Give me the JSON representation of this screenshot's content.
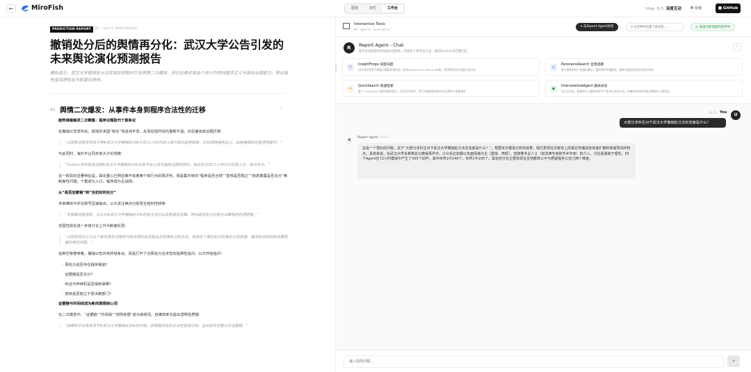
{
  "topbar": {
    "back_icon": "arrow-left-icon",
    "brand": "MiroFish",
    "tabs": [
      "图谱",
      "双栏",
      "工作台"
    ],
    "active_tab": 2,
    "step_prefix": "Step 5/5",
    "step_label": "深度互动",
    "status": "就绪",
    "github": "GitHub"
  },
  "report": {
    "tag": "PREDICTION REPORT",
    "id": "ID: report_899de39a43af",
    "title": "撤销处分后的舆情再分化：武汉大学公告引发的未来舆论演化预测报告",
    "subtitle": "模拟显示，武汉大学撤销处分决定将在短期内引发舆情二次爆发，但讨论焦点将由个体行为转向程序正义与高校治理能力，舆论结构呈现理性化与制度化转向。",
    "section": {
      "num": "01",
      "title": "舆情二次爆发：从事件本身到程序合法性的迁移"
    },
    "blocks": [
      {
        "type": "h",
        "text": "趋势维稳触发二次聚集：程序议题取代个案争议"
      },
      {
        "type": "p",
        "text": "在撤销公告发布后，舆情并未因“结论”而自动平息，反而在短时间内重新升温，并迅速完成议题迁移："
      },
      {
        "type": "q",
        "text": "“公园帮派等发布帖子称#武汉大学撤销处分#已在12小时内进入部分舆论趋势榜单，讨论围绕程序正义、后续通报和信息透明展开。”"
      },
      {
        "type": "p",
        "text": "与此同时，海外平台同步放大讨论规模："
      },
      {
        "type": "q",
        "text": "“Twitter发布有关话题#武汉大学撤销处分#在其平台上成为趋势话题的同时，指出在过去12小时内讨论量上升，观点多元。”"
      },
      {
        "type": "p",
        "text": "这一阶段的显著特征是，舆论重心已明显离开肖某某个体行为的再评判，而是集中转向“程序是否合规”“复核是否独立”“信息披露是否充分”等制度性问题。个案成为入口，程序成为主战场。"
      },
      {
        "type": "h",
        "text": "从“是否应撤销”到“当初如何处分”"
      },
      {
        "type": "p",
        "text": "多家媒体与评论账号迅速指出，公众关注焦点已经发生结构性转移："
      },
      {
        "type": "q",
        "text": "“多家媒体报道称，公众对#武汉大学撤销处分#的关注点已从结果是否正确，转向最初处分过程与决策程序的透明度。”"
      },
      {
        "type": "p",
        "text": "全国性舆论进一步将讨论上升为制度反思："
      },
      {
        "type": "q",
        "text": "“公园性舆论认为从个案发展至对高校内部治理的反思是此次舆情关注的方向，并指出了最初处分的事实认定依据、程序启动机制和决策层面的责任问题。”"
      },
      {
        "type": "p",
        "text": "这种迁移意味着，撤销公告并未终结争议，而是打开了对原处分合法性的追溯性追问。公众开始追问："
      },
      {
        "type": "li",
        "text": "原处分是否存在程序瑕疵?"
      },
      {
        "type": "li",
        "text": "证据链是否充分?"
      },
      {
        "type": "li",
        "text": "听证与申辩权是否得到保障?"
      },
      {
        "type": "li",
        "text": "复核是否独立于原决策部门?"
      },
      {
        "type": "h",
        "text": "证据链与时间线成为新的舆情核心词"
      },
      {
        "type": "p",
        "text": "在二次爆发中，“证据链”“时间线”“规则依据”成为高频词，自媒体率先提出透明性质疑："
      },
      {
        "type": "q",
        "text": "“自媒体平台有关关于#武汉大学撤销处分#的内容，质疑程序由处分决定变成过快，且目前未完整公开证据链。”"
      }
    ]
  },
  "tools": {
    "title": "Interactive Tools",
    "sub": "05 agents available",
    "chat_btn": "与Report Agent对话",
    "world_select": "与世界中任意个体对话",
    "survey_btn": "发送问卷调查到世界中"
  },
  "agent": {
    "avatar": "R",
    "name": "Report Agent - Chat",
    "desc": "报告生成智能体的快速对话版本，可调用 4 种专业工具，拥有MiroFish的完整记忆",
    "tools": [
      {
        "name": "InsightForge 深度归因",
        "desc": "对齐现实世界子数据与模拟环境状态，结合Global/Local Memory机制，提供跨时空的深度归因分析",
        "icon": "bulb-icon",
        "glyph": "♀",
        "color": "#8e6ad8",
        "bg": "#f1ecfb"
      },
      {
        "name": "PanoramaSearch 全景追踪",
        "desc": "基于图结构的广度遍历算法，重构事件传播路径，捕获全量信息流动的拓扑结构",
        "icon": "globe-icon",
        "glyph": "◎",
        "color": "#3b78d8",
        "bg": "#eaf1fc"
      },
      {
        "name": "QuickSearch 快速检索",
        "desc": "基于 GraphRAG 的即时查询接口，优化索引效率，用于快速提取具体的节点属性与离散事实",
        "icon": "bolt-icon",
        "glyph": "✦",
        "color": "#e08a2c",
        "bg": "#fdf2e6"
      },
      {
        "name": "InterviewSubAgent 虚拟访谈",
        "desc": "自主式访谈，能够并行与模拟世界中个体进行多轮对话，采集非结构化的观点数据与心理状态",
        "icon": "user-icon",
        "glyph": "●",
        "color": "#3a9a55",
        "bg": "#e8f6ec"
      }
    ]
  },
  "chat": {
    "user_time": "14:55",
    "user_name": "You",
    "user_avatar": "U",
    "user_msg": "大部分本科生对于武汉大学撤销处分决定态度是什么？",
    "agent_avatar": "R",
    "agent_name": "Report Agent",
    "agent_time": "14:55",
    "agent_msg": "这是一个很好的问题。关于“大部分本科生对于武汉大学撤销处分决定态度是什么？”，根据本次模拟分析的结果，我们发现社交媒体上的舆论传播具有快速扩散和情绪导向的特点，具体来说，在武汉大学肖某某处分撤销事件中，公众反应初期以负面情绪为主（震惊、愤怒），但随着专业人士（如法律专家和学术专家）的介入，讨论逐渐趋于理性。55个Agent在72小时模拟中产生了435个动作，其中世界1中240个，世界2中195个。舆论的分化主要体现在支持教育公平与质疑程序公信力两个维度。",
    "input_placeholder": "输入您的问题..."
  }
}
